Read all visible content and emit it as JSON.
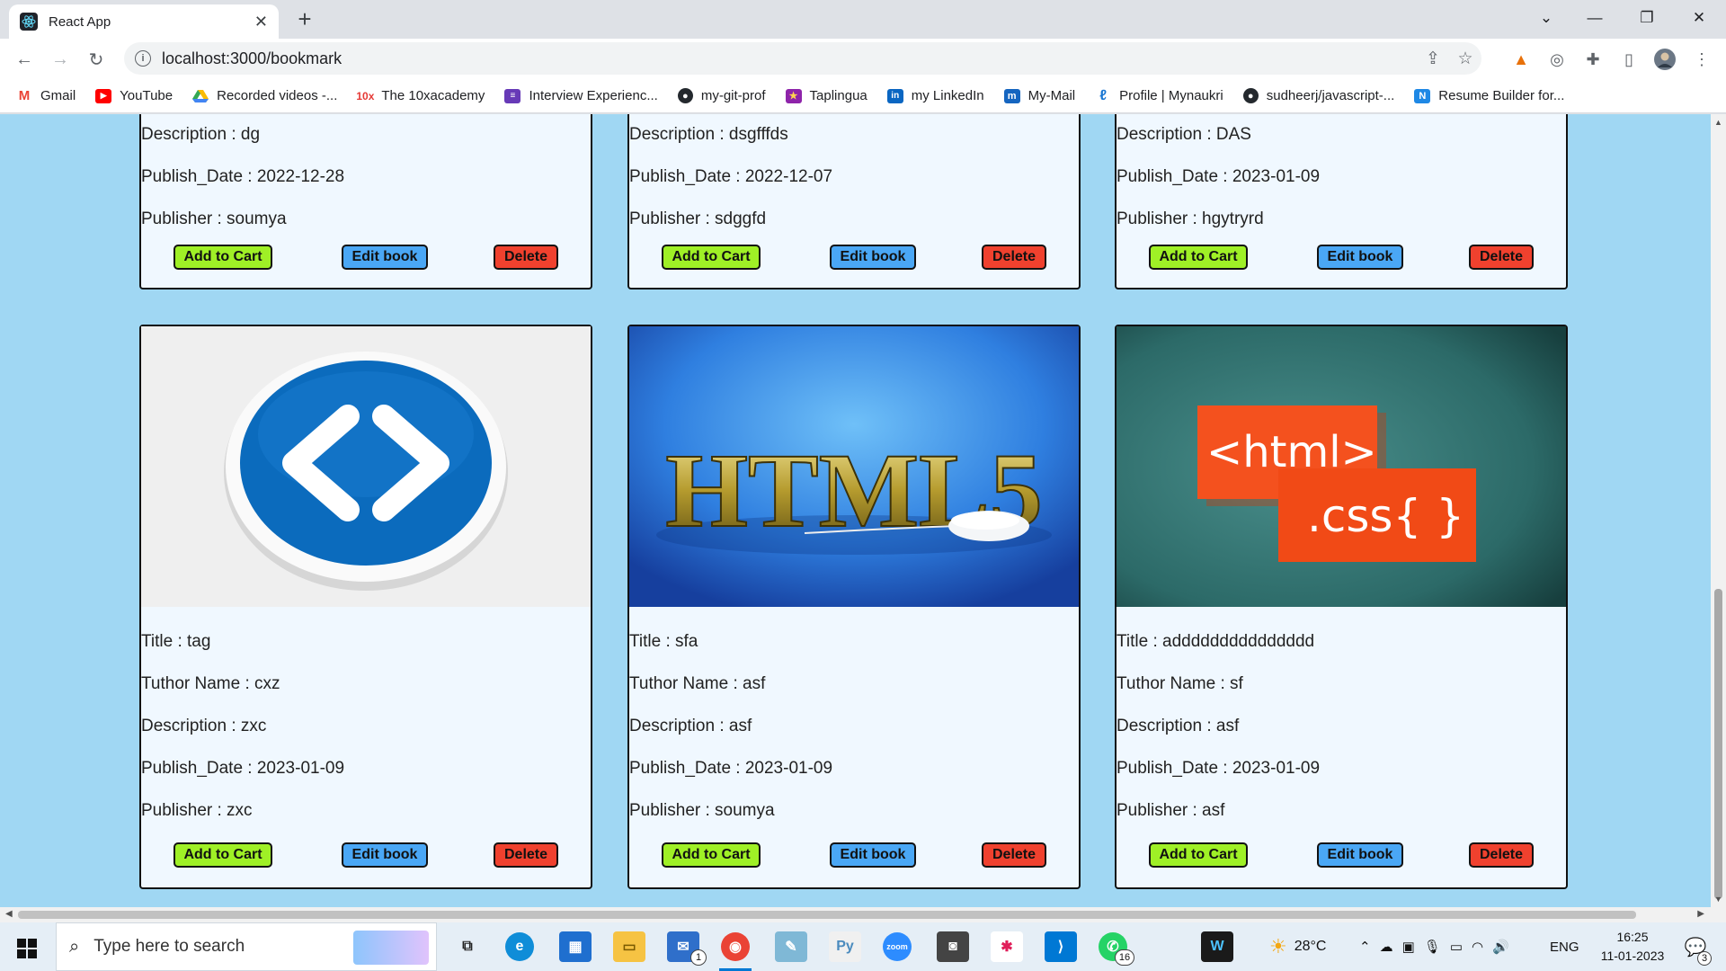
{
  "browser": {
    "tab_title": "React App",
    "url": "localhost:3000/bookmark"
  },
  "bookmarks": [
    {
      "label": "Gmail",
      "icon": "gmail-icon",
      "color": "#ea4335"
    },
    {
      "label": "YouTube",
      "icon": "youtube-icon",
      "color": "#ff0000"
    },
    {
      "label": "Recorded videos -...",
      "icon": "google-drive-icon",
      "color": "#34a853"
    },
    {
      "label": "The 10xacademy",
      "icon": "10x-icon",
      "color": "#e53935"
    },
    {
      "label": "Interview Experienc...",
      "icon": "form-icon",
      "color": "#673ab7"
    },
    {
      "label": "my-git-prof",
      "icon": "github-icon",
      "color": "#24292e"
    },
    {
      "label": "Taplingua",
      "icon": "star-icon",
      "color": "#8e24aa"
    },
    {
      "label": "my LinkedIn",
      "icon": "linkedin-icon",
      "color": "#0a66c2"
    },
    {
      "label": "My-Mail",
      "icon": "mail-icon",
      "color": "#1565c0"
    },
    {
      "label": "Profile | Mynaukri",
      "icon": "naukri-icon",
      "color": "#1976d2"
    },
    {
      "label": "sudheerj/javascript-...",
      "icon": "github-icon",
      "color": "#24292e"
    },
    {
      "label": "Resume Builder for...",
      "icon": "novoresume-icon",
      "color": "#1e88e5"
    }
  ],
  "buttons": {
    "add_to_cart": "Add to Cart",
    "edit_book": "Edit book",
    "delete": "Delete"
  },
  "top_cards": [
    {
      "description": "Description : dg",
      "publish_date": "Publish_Date : 2022-12-28",
      "publisher": "Publisher : soumya"
    },
    {
      "description": "Description : dsgfffds",
      "publish_date": "Publish_Date : 2022-12-07",
      "publisher": "Publisher : sdggfd"
    },
    {
      "description": "Description : DAS",
      "publish_date": "Publish_Date : 2023-01-09",
      "publisher": "Publisher : hgytryrd"
    }
  ],
  "bottom_cards": [
    {
      "title": "Title : tag",
      "tutor": "Tuthor Name : cxz",
      "description": "Description : zxc",
      "publish_date": "Publish_Date : 2023-01-09",
      "publisher": "Publisher : zxc",
      "image": "code-brackets-icon"
    },
    {
      "title": "Title : sfa",
      "tutor": "Tuthor Name : asf",
      "description": "Description : asf",
      "publish_date": "Publish_Date : 2023-01-09",
      "publisher": "Publisher : soumya",
      "image_text": "HTML5"
    },
    {
      "title": "Title : addddddddddddddd",
      "tutor": "Tuthor Name : sf",
      "description": "Description : asf",
      "publish_date": "Publish_Date : 2023-01-09",
      "publisher": "Publisher : asf",
      "image_text_1": "<html>",
      "image_text_2": ".css{ }"
    }
  ],
  "taskbar": {
    "search_placeholder": "Type here to search",
    "weather": "28°C",
    "language": "ENG",
    "time": "16:25",
    "date": "11-01-2023",
    "mail_badge": "1",
    "whatsapp_badge": "16",
    "notification_badge": "3"
  }
}
